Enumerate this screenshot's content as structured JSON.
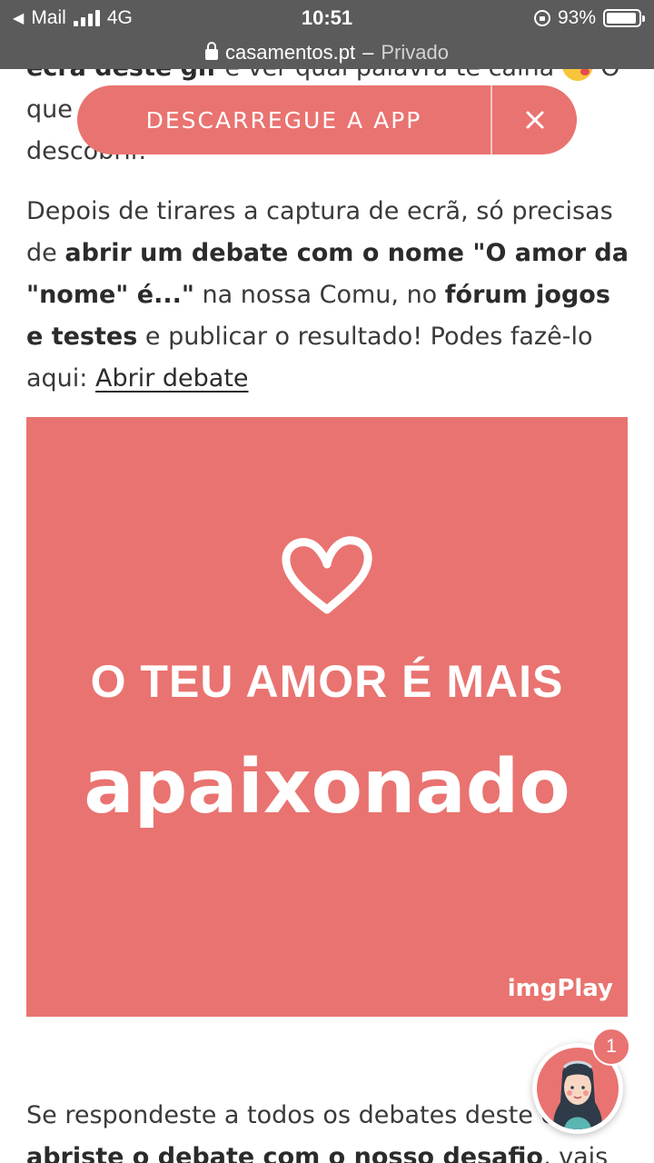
{
  "status_bar": {
    "back_app": "Mail",
    "network": "4G",
    "time": "10:51",
    "battery": "93%",
    "battery_level": 0.93
  },
  "url_bar": {
    "domain": "casamentos.pt",
    "separator": "–",
    "mode": "Privado"
  },
  "app_banner": {
    "label": "DESCARREGUE A APP",
    "close": "×"
  },
  "article": {
    "top_bold": "ecrá deste gif",
    "top_text": " e ver qual palavra te calha ",
    "top_trailing": "O",
    "top_line2": "que",
    "top_line3": "descobrir.",
    "p1_a": "Depois de tirares a captura de ecrã, só precisas de ",
    "p1_b": "abrir um debate com o nome \"O amor da \"nome\" é...\"",
    "p1_c": " na nossa Comu, no ",
    "p1_d": "fórum jogos e testes",
    "p1_e": " e publicar o resultado! Podes fazê-lo aqui: ",
    "p1_link": "Abrir debate",
    "p2_a": "Se respondeste a todos os debates deste ",
    "p2_trailing": "e",
    "p2_b": "abriste o debate com o nosso desafio",
    "p2_c": ", vais"
  },
  "gif": {
    "line1": "O TEU AMOR É MAIS",
    "line2": "apaixonado",
    "watermark": "imgPlay",
    "bg_color": "#e97370"
  },
  "chat": {
    "badge_count": "1"
  },
  "colors": {
    "brand": "#e97370",
    "status_bar_bg": "#5b5b5b"
  }
}
